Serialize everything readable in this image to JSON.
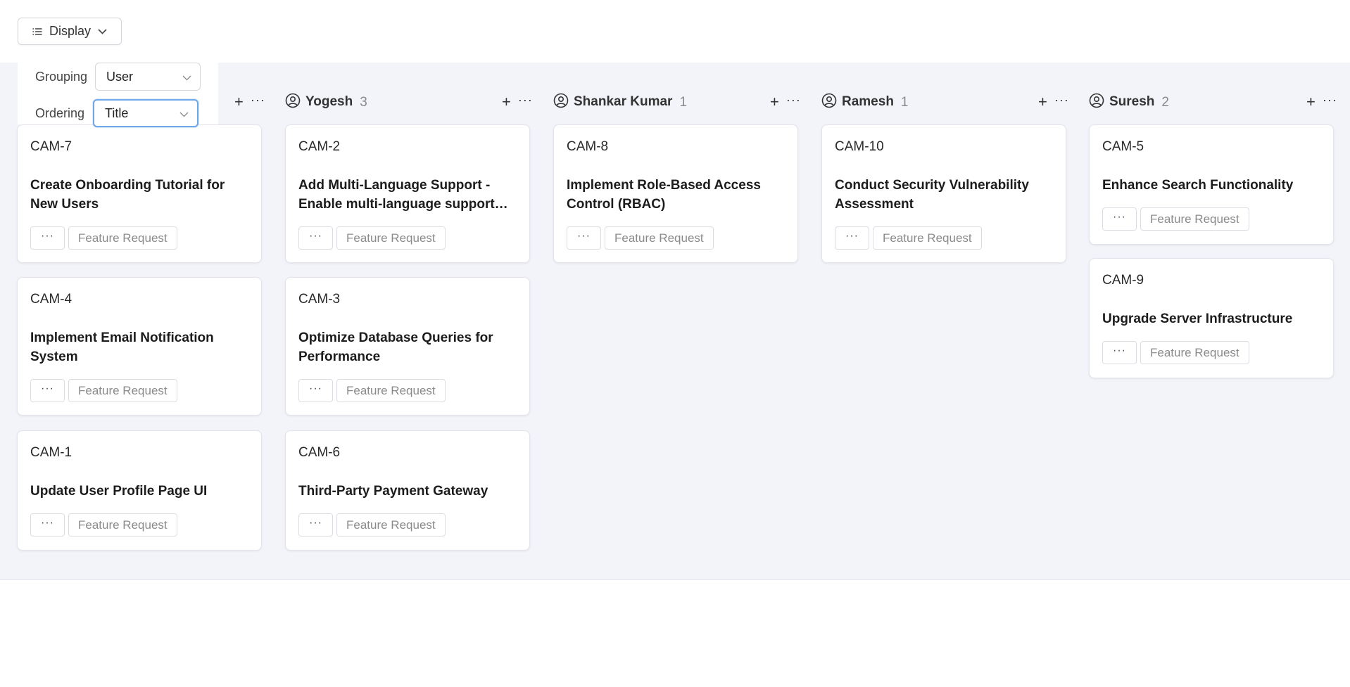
{
  "toolbar": {
    "display_label": "Display"
  },
  "display_panel": {
    "grouping_label": "Grouping",
    "grouping_value": "User",
    "ordering_label": "Ordering",
    "ordering_value": "Title"
  },
  "columns": [
    {
      "name": "",
      "count": "",
      "cards": [
        {
          "id": "CAM-7",
          "title": "Create Onboarding Tutorial for New Users",
          "tag": "Feature Request"
        },
        {
          "id": "CAM-4",
          "title": "Implement Email Notification System",
          "tag": "Feature Request"
        },
        {
          "id": "CAM-1",
          "title": "Update User Profile Page UI",
          "tag": "Feature Request"
        }
      ]
    },
    {
      "name": "Yogesh",
      "count": "3",
      "cards": [
        {
          "id": "CAM-2",
          "title": "Add Multi-Language Support - Enable multi-language support…",
          "tag": "Feature Request"
        },
        {
          "id": "CAM-3",
          "title": "Optimize Database Queries for Performance",
          "tag": "Feature Request"
        },
        {
          "id": "CAM-6",
          "title": "Third-Party Payment Gateway",
          "tag": "Feature Request"
        }
      ]
    },
    {
      "name": "Shankar Kumar",
      "count": "1",
      "cards": [
        {
          "id": "CAM-8",
          "title": "Implement Role-Based Access Control (RBAC)",
          "tag": "Feature Request"
        }
      ]
    },
    {
      "name": "Ramesh",
      "count": "1",
      "cards": [
        {
          "id": "CAM-10",
          "title": "Conduct Security Vulnerability Assessment",
          "tag": "Feature Request"
        }
      ]
    },
    {
      "name": "Suresh",
      "count": "2",
      "cards": [
        {
          "id": "CAM-5",
          "title": "Enhance Search Functionality",
          "tag": "Feature Request"
        },
        {
          "id": "CAM-9",
          "title": "Upgrade Server Infrastructure",
          "tag": "Feature Request"
        }
      ]
    }
  ],
  "icons": {
    "display": "list-icon",
    "chevron": "chevron-down-icon",
    "user": "user-circle-icon",
    "add": "plus-icon",
    "more": "more-horizontal-icon"
  },
  "colors": {
    "board_background": "#f3f4fa",
    "focus_ring": "#6ea8e8",
    "muted_text": "#8a8a8a"
  }
}
